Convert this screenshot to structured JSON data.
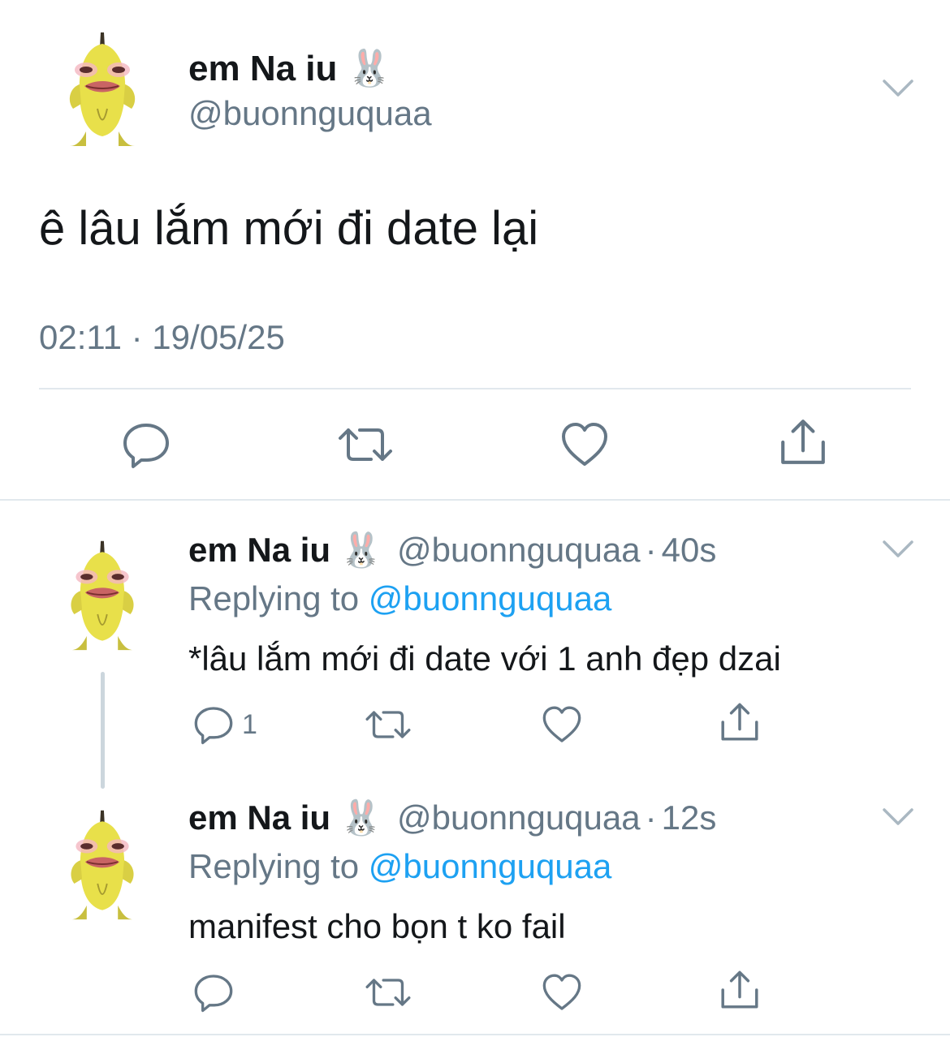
{
  "main_tweet": {
    "display_name": "em Na iu",
    "name_emoji": "🐰",
    "handle": "@buonnguquaa",
    "text": "ê lâu lắm mới đi date lại",
    "timestamp": "02:11 · 19/05/25",
    "avatar_icon": "banana-avatar-icon",
    "actions": [
      "reply-icon",
      "retweet-icon",
      "like-icon",
      "share-icon"
    ]
  },
  "replies": [
    {
      "display_name": "em Na iu",
      "name_emoji": "🐰",
      "handle": "@buonnguquaa",
      "separator": "·",
      "age": "40s",
      "replying_prefix": "Replying to",
      "replying_to": "@buonnguquaa",
      "text": "*lâu lắm mới đi date với 1 anh đẹp dzai",
      "reply_count": "1"
    },
    {
      "display_name": "em Na iu",
      "name_emoji": "🐰",
      "handle": "@buonnguquaa",
      "separator": "·",
      "age": "12s",
      "replying_prefix": "Replying to",
      "replying_to": "@buonnguquaa",
      "text": "manifest cho bọn t ko fail",
      "reply_count": ""
    }
  ],
  "colors": {
    "text": "#14171a",
    "secondary": "#657786",
    "link": "#1da1f2",
    "divider": "#e1e8ed",
    "thread_line": "#ccd6dd",
    "avatar_banana": "#e8e04a"
  }
}
